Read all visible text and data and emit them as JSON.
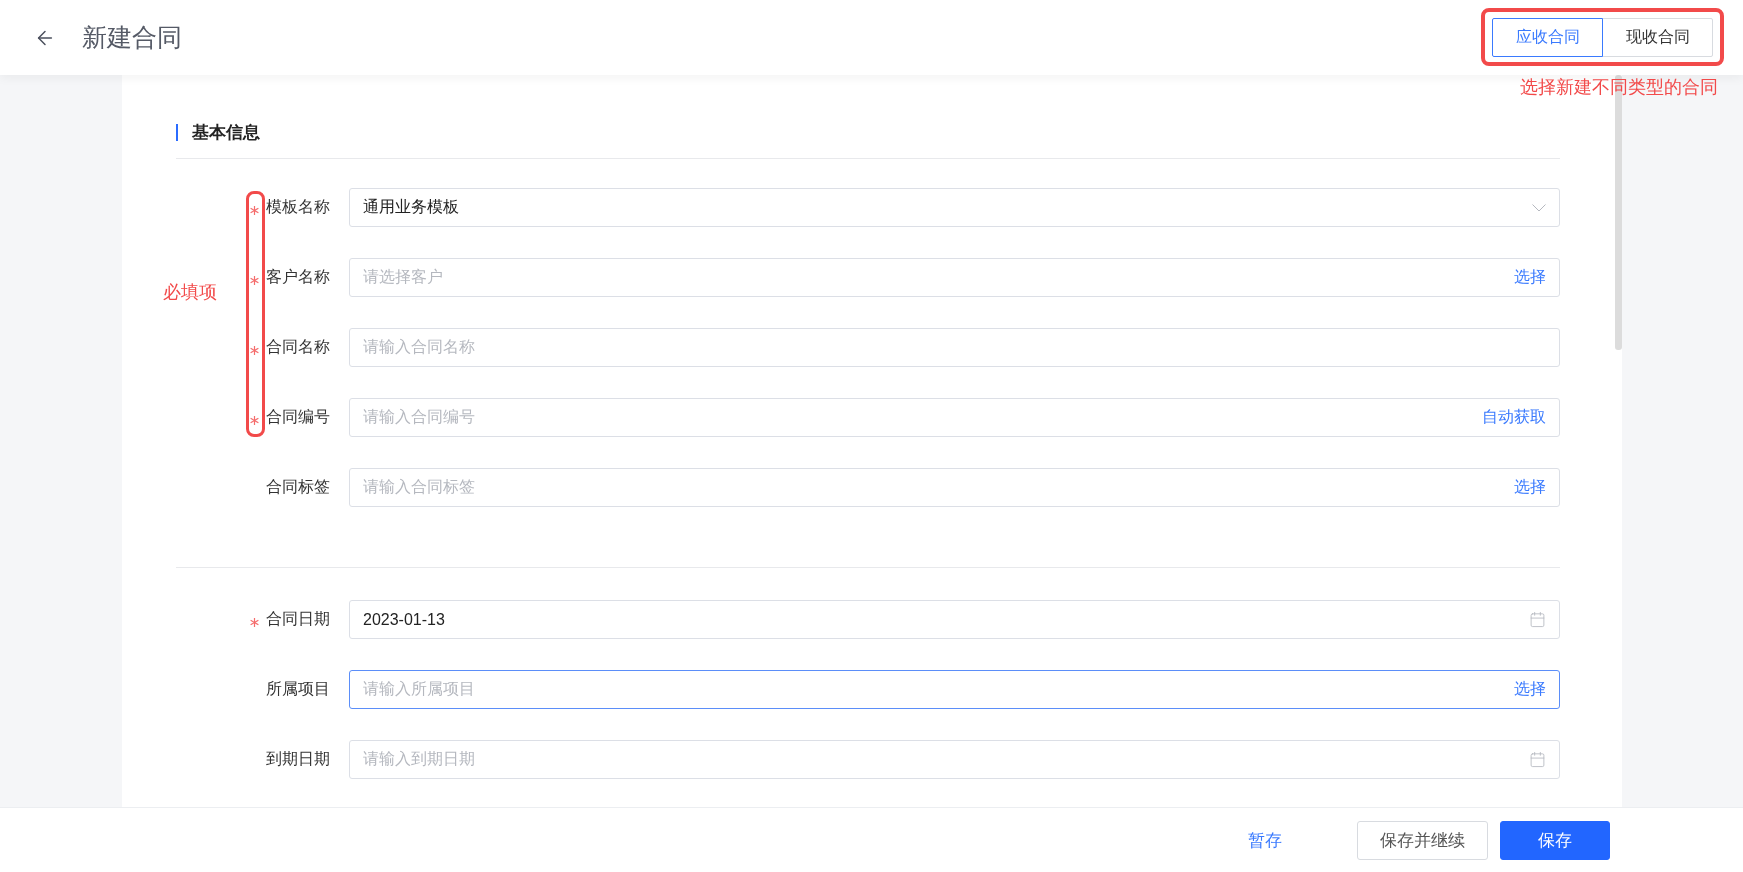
{
  "header": {
    "title": "新建合同",
    "contract_types": [
      {
        "label": "应收合同",
        "selected": true
      },
      {
        "label": "现收合同",
        "selected": false
      }
    ]
  },
  "section": {
    "title": "基本信息"
  },
  "field_groups": [
    [
      {
        "label": "模板名称",
        "required": true,
        "value": "通用业务模板",
        "suffix": {
          "kind": "dropdown"
        },
        "focused": false
      },
      {
        "label": "客户名称",
        "required": true,
        "placeholder": "请选择客户",
        "suffix": {
          "kind": "action",
          "text": "选择"
        },
        "focused": false
      },
      {
        "label": "合同名称",
        "required": true,
        "placeholder": "请输入合同名称",
        "focused": false
      },
      {
        "label": "合同编号",
        "required": true,
        "placeholder": "请输入合同编号",
        "suffix": {
          "kind": "action",
          "text": "自动获取"
        },
        "focused": false
      },
      {
        "label": "合同标签",
        "required": false,
        "placeholder": "请输入合同标签",
        "suffix": {
          "kind": "action",
          "text": "选择"
        },
        "focused": false
      }
    ],
    [
      {
        "label": "合同日期",
        "required": true,
        "value": "2023-01-13",
        "suffix": {
          "kind": "calendar"
        },
        "focused": false
      },
      {
        "label": "所属项目",
        "required": false,
        "placeholder": "请输入所属项目",
        "suffix": {
          "kind": "action",
          "text": "选择"
        },
        "focused": true
      },
      {
        "label": "到期日期",
        "required": false,
        "placeholder": "请输入到期日期",
        "suffix": {
          "kind": "calendar"
        },
        "focused": false
      }
    ]
  ],
  "footer": {
    "buttons": [
      {
        "label": "暂存",
        "kind": "text"
      },
      {
        "label": "保存并继续",
        "kind": "default"
      },
      {
        "label": "保存",
        "kind": "primary"
      }
    ]
  },
  "annotations": {
    "required_note": "必填项",
    "type_note": "选择新建不同类型的合同"
  }
}
